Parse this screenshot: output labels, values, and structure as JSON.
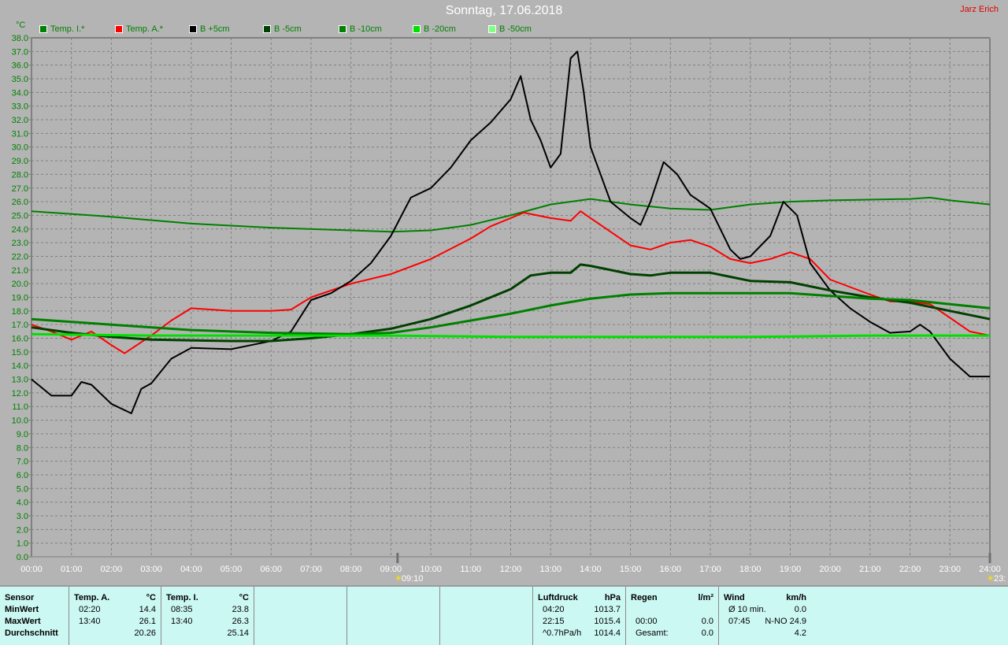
{
  "chart_data": {
    "type": "line",
    "title": "Sonntag, 17.06.2018",
    "author": "Jarz Erich",
    "ylabel": "°C",
    "ylim": [
      0,
      38
    ],
    "xlim": [
      0,
      24
    ],
    "yticks": [
      "0.0",
      "1.0",
      "2.0",
      "3.0",
      "4.0",
      "5.0",
      "6.0",
      "7.0",
      "8.0",
      "9.0",
      "10.0",
      "11.0",
      "12.0",
      "13.0",
      "14.0",
      "15.0",
      "16.0",
      "17.0",
      "18.0",
      "19.0",
      "20.0",
      "21.0",
      "22.0",
      "23.0",
      "24.0",
      "25.0",
      "26.0",
      "27.0",
      "28.0",
      "29.0",
      "30.0",
      "31.0",
      "32.0",
      "33.0",
      "34.0",
      "35.0",
      "36.0",
      "37.0",
      "38.0"
    ],
    "xticks": [
      "00:00",
      "01:00",
      "02:00",
      "03:00",
      "04:00",
      "05:00",
      "06:00",
      "07:00",
      "08:00",
      "09:00",
      "10:00",
      "11:00",
      "12:00",
      "13:00",
      "14:00",
      "15:00",
      "16:00",
      "17:00",
      "18:00",
      "19:00",
      "20:00",
      "21:00",
      "22:00",
      "23:00",
      "24:00"
    ],
    "grid": true,
    "legend_position": "top",
    "markers": [
      {
        "x": 9.1667,
        "label": "09:10"
      },
      {
        "x": 24,
        "label": "23:"
      }
    ],
    "series": [
      {
        "name": "Temp. I.*",
        "color": "#008000",
        "width": 2,
        "x": [
          0,
          2,
          4,
          6,
          8,
          9,
          10,
          11,
          12,
          13,
          14,
          15,
          16,
          17,
          18,
          19,
          20,
          22,
          22.5,
          23,
          24
        ],
        "y": [
          25.3,
          24.9,
          24.4,
          24.1,
          23.9,
          23.8,
          23.9,
          24.3,
          25.0,
          25.8,
          26.2,
          25.8,
          25.5,
          25.4,
          25.8,
          26.0,
          26.1,
          26.2,
          26.3,
          26.1,
          25.8
        ]
      },
      {
        "name": "Temp. A.*",
        "color": "#ff0000",
        "width": 2,
        "x": [
          0,
          0.5,
          1,
          1.5,
          2,
          2.33,
          3,
          3.5,
          4,
          5,
          6,
          6.5,
          7,
          8,
          9,
          10,
          11,
          11.5,
          12,
          12.33,
          13,
          13.5,
          13.75,
          14,
          15,
          15.5,
          16,
          16.5,
          17,
          17.5,
          18,
          18.5,
          19,
          19.5,
          20,
          21,
          21.5,
          22,
          22.5,
          23,
          23.5,
          24
        ],
        "y": [
          17.0,
          16.5,
          15.9,
          16.5,
          15.5,
          14.9,
          16.2,
          17.3,
          18.2,
          18.0,
          18.0,
          18.1,
          19.0,
          20.0,
          20.7,
          21.8,
          23.3,
          24.2,
          24.8,
          25.2,
          24.8,
          24.6,
          25.3,
          24.8,
          22.8,
          22.5,
          23.0,
          23.2,
          22.7,
          21.8,
          21.5,
          21.8,
          22.3,
          21.8,
          20.3,
          19.2,
          18.7,
          18.7,
          18.5,
          17.5,
          16.5,
          16.2
        ]
      },
      {
        "name": "B +5cm",
        "color": "#000000",
        "width": 2,
        "x": [
          0,
          0.5,
          1,
          1.25,
          1.5,
          2,
          2.5,
          2.75,
          3,
          3.5,
          4,
          5,
          5.5,
          6,
          6.5,
          7,
          7.5,
          8,
          8.5,
          9,
          9.5,
          10,
          10.5,
          11,
          11.5,
          12,
          12.25,
          12.5,
          12.75,
          13,
          13.25,
          13.5,
          13.67,
          13.83,
          14,
          14.5,
          15,
          15.25,
          15.5,
          15.83,
          16.17,
          16.5,
          17,
          17.5,
          17.75,
          18,
          18.5,
          18.83,
          19.17,
          19.5,
          20,
          20.5,
          21,
          21.5,
          22,
          22.25,
          22.5,
          23,
          23.5,
          24
        ],
        "y": [
          13.0,
          11.8,
          11.8,
          12.8,
          12.6,
          11.2,
          10.5,
          12.3,
          12.7,
          14.5,
          15.3,
          15.2,
          15.5,
          15.8,
          16.5,
          18.8,
          19.3,
          20.2,
          21.5,
          23.5,
          26.3,
          27.0,
          28.5,
          30.5,
          31.8,
          33.5,
          35.2,
          32.0,
          30.5,
          28.5,
          29.5,
          36.5,
          37.0,
          34.0,
          30.0,
          26.0,
          24.8,
          24.3,
          26.0,
          28.9,
          28.0,
          26.5,
          25.5,
          22.5,
          21.8,
          22.0,
          23.5,
          26.0,
          25.0,
          21.5,
          19.5,
          18.2,
          17.2,
          16.4,
          16.5,
          17.0,
          16.5,
          14.5,
          13.2,
          13.2
        ]
      },
      {
        "name": "B -5cm",
        "color": "#004000",
        "width": 3,
        "x": [
          0,
          1,
          2,
          3,
          5,
          6,
          7,
          8,
          9,
          10,
          11,
          12,
          12.5,
          13,
          13.5,
          13.75,
          14,
          15,
          15.5,
          16,
          17,
          17.5,
          18,
          19,
          20,
          21,
          22,
          23,
          24
        ],
        "y": [
          16.8,
          16.4,
          16.1,
          15.9,
          15.8,
          15.8,
          16.0,
          16.3,
          16.7,
          17.4,
          18.4,
          19.6,
          20.6,
          20.8,
          20.8,
          21.4,
          21.3,
          20.7,
          20.6,
          20.8,
          20.8,
          20.5,
          20.2,
          20.1,
          19.5,
          19.0,
          18.6,
          18.0,
          17.4
        ]
      },
      {
        "name": "B -10cm",
        "color": "#008000",
        "width": 3,
        "x": [
          0,
          2,
          4,
          6,
          8,
          9,
          10,
          11,
          12,
          13,
          14,
          15,
          16,
          18,
          19,
          20,
          21,
          22,
          23,
          24
        ],
        "y": [
          17.4,
          17.0,
          16.6,
          16.4,
          16.3,
          16.4,
          16.8,
          17.3,
          17.8,
          18.4,
          18.9,
          19.2,
          19.3,
          19.3,
          19.3,
          19.1,
          18.9,
          18.8,
          18.5,
          18.2
        ]
      },
      {
        "name": "B -20cm",
        "color": "#00e000",
        "width": 3,
        "x": [
          0,
          3,
          6,
          9,
          12,
          15,
          18,
          21,
          24
        ],
        "y": [
          16.3,
          16.2,
          16.2,
          16.2,
          16.1,
          16.1,
          16.1,
          16.2,
          16.2
        ]
      },
      {
        "name": "B -50cm",
        "color": "#80ff80",
        "width": 2,
        "x": [],
        "y": []
      }
    ]
  },
  "summary": {
    "columns": [
      {
        "header": "Sensor",
        "unit": "",
        "rows": [
          [
            "MinWert",
            ""
          ],
          [
            "MaxWert",
            ""
          ],
          [
            "Durchschnitt",
            ""
          ]
        ],
        "bold_left": true
      },
      {
        "header": "Temp. A.",
        "unit": "°C",
        "rows": [
          [
            "02:20",
            "14.4"
          ],
          [
            "13:40",
            "26.1"
          ],
          [
            "",
            "20.26"
          ]
        ]
      },
      {
        "header": "Temp. I.",
        "unit": "°C",
        "rows": [
          [
            "08:35",
            "23.8"
          ],
          [
            "13:40",
            "26.3"
          ],
          [
            "",
            "25.14"
          ]
        ]
      },
      {
        "header": "",
        "unit": "",
        "rows": [
          [
            "",
            ""
          ],
          [
            "",
            ""
          ],
          [
            "",
            ""
          ]
        ]
      },
      {
        "header": "",
        "unit": "",
        "rows": [
          [
            "",
            ""
          ],
          [
            "",
            ""
          ],
          [
            "",
            ""
          ]
        ]
      },
      {
        "header": "",
        "unit": "",
        "rows": [
          [
            "",
            ""
          ],
          [
            "",
            ""
          ],
          [
            "",
            ""
          ]
        ]
      },
      {
        "header": "Luftdruck",
        "unit": "hPa",
        "rows": [
          [
            "04:20",
            "1013.7"
          ],
          [
            "22:15",
            "1015.4"
          ],
          [
            "^0.7hPa/h",
            "1014.4"
          ]
        ]
      },
      {
        "header": "Regen",
        "unit": "l/m²",
        "rows": [
          [
            "",
            ""
          ],
          [
            "00:00",
            "0.0"
          ],
          [
            "Gesamt:",
            "0.0"
          ]
        ]
      },
      {
        "header": "Wind",
        "unit": "km/h",
        "rows": [
          [
            "Ø 10 min.",
            "0.0"
          ],
          [
            "07:45",
            "N-NO 24.9"
          ],
          [
            "",
            "4.2"
          ]
        ]
      }
    ]
  }
}
